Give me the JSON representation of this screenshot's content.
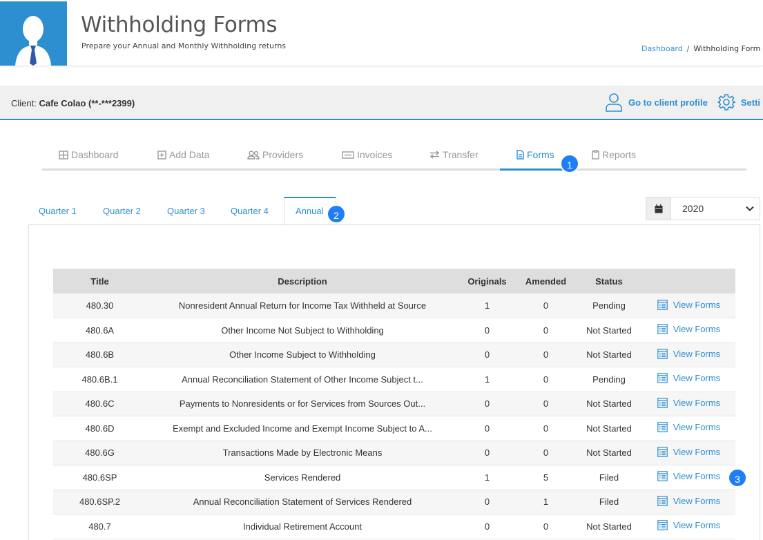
{
  "header": {
    "title": "Withholding Forms",
    "subtitle": "Prepare your Annual and Monthly Withholding returns",
    "breadcrumb": {
      "home": "Dashboard",
      "separator": "/",
      "current": "Withholding Form"
    }
  },
  "client": {
    "label": "Client:",
    "name": "Cafe Colao (**-***2399)",
    "profile_link": "Go to client profile",
    "settings_link": "Setti"
  },
  "nav": {
    "items": [
      {
        "label": "Dashboard",
        "icon": "grid-icon"
      },
      {
        "label": "Add Data",
        "icon": "plus-square-icon"
      },
      {
        "label": "Providers",
        "icon": "users-icon"
      },
      {
        "label": "Invoices",
        "icon": "invoice-icon"
      },
      {
        "label": "Transfer",
        "icon": "transfer-icon"
      },
      {
        "label": "Forms",
        "icon": "file-icon",
        "active": true
      },
      {
        "label": "Reports",
        "icon": "clipboard-icon"
      }
    ]
  },
  "badges": [
    "1",
    "2",
    "3"
  ],
  "tabs": {
    "items": [
      "Quarter 1",
      "Quarter 2",
      "Quarter 3",
      "Quarter 4"
    ],
    "active": "Annual"
  },
  "year": {
    "value": "2020"
  },
  "table": {
    "headers": {
      "title": "Title",
      "description": "Description",
      "originals": "Originals",
      "amended": "Amended",
      "status": "Status",
      "action": ""
    },
    "action_label": "View Forms",
    "rows": [
      {
        "title": "480.30",
        "description": "Nonresident Annual Return for Income Tax Withheld at Source",
        "originals": "1",
        "amended": "0",
        "status": "Pending"
      },
      {
        "title": "480.6A",
        "description": "Other Income Not Subject to Withholding",
        "originals": "0",
        "amended": "0",
        "status": "Not Started"
      },
      {
        "title": "480.6B",
        "description": "Other Income Subject to Withholding",
        "originals": "0",
        "amended": "0",
        "status": "Not Started"
      },
      {
        "title": "480.6B.1",
        "description": "Annual Reconciliation Statement of Other Income Subject t...",
        "originals": "1",
        "amended": "0",
        "status": "Pending"
      },
      {
        "title": "480.6C",
        "description": "Payments to Nonresidents or for Services from Sources Out...",
        "originals": "0",
        "amended": "0",
        "status": "Not Started"
      },
      {
        "title": "480.6D",
        "description": "Exempt and Excluded Income and Exempt Income Subject to A...",
        "originals": "0",
        "amended": "0",
        "status": "Not Started"
      },
      {
        "title": "480.6G",
        "description": "Transactions Made by Electronic Means",
        "originals": "0",
        "amended": "0",
        "status": "Not Started"
      },
      {
        "title": "480.6SP",
        "description": "Services Rendered",
        "originals": "1",
        "amended": "5",
        "status": "Filed"
      },
      {
        "title": "480.6SP.2",
        "description": "Annual Reconciliation Statement of Services Rendered",
        "originals": "0",
        "amended": "1",
        "status": "Filed"
      },
      {
        "title": "480.7",
        "description": "Individual Retirement Account",
        "originals": "0",
        "amended": "0",
        "status": "Not Started"
      }
    ]
  },
  "colors": {
    "accent": "#2d8fd0",
    "badge": "#1e7ef5",
    "header_bg": "#dedede"
  }
}
